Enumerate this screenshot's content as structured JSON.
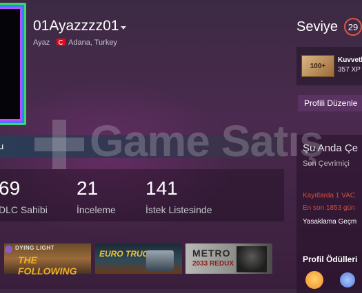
{
  "profile": {
    "username": "01Ayazzzz01",
    "real_name": "Ayaz",
    "location": "Adana, Turkey"
  },
  "level": {
    "label": "Seviye",
    "value": "29"
  },
  "badge": {
    "icon_text": "100+",
    "name": "Kuvvetli",
    "xp": "357 XP"
  },
  "edit_profile_label": "Profili Düzenle",
  "tab_strip_text": "u",
  "stats": [
    {
      "value": "69",
      "label": "DLC Sahibi"
    },
    {
      "value": "21",
      "label": "İnceleme"
    },
    {
      "value": "141",
      "label": "İstek Listesinde"
    }
  ],
  "games": [
    {
      "title": "DYING LIGHT",
      "subtitle": "THE FOLLOWING"
    },
    {
      "title": "EURO TRUCK"
    },
    {
      "title": "METRO",
      "subtitle": "2033 REDUX"
    }
  ],
  "status": {
    "title": "Şu Anda Çe",
    "subtitle": "Son Çevrimiçi",
    "ban_line1": "Kayıtlarda 1 VAC",
    "ban_line2": "En son 1853 gün",
    "ban_history": "Yasaklama Geçm"
  },
  "awards_title": "Profil Ödülleri",
  "watermark": "Game Satış",
  "colors": {
    "level_ring": "#e0563f",
    "ban_text": "#d3503c",
    "edit_button": "#5b3363"
  }
}
